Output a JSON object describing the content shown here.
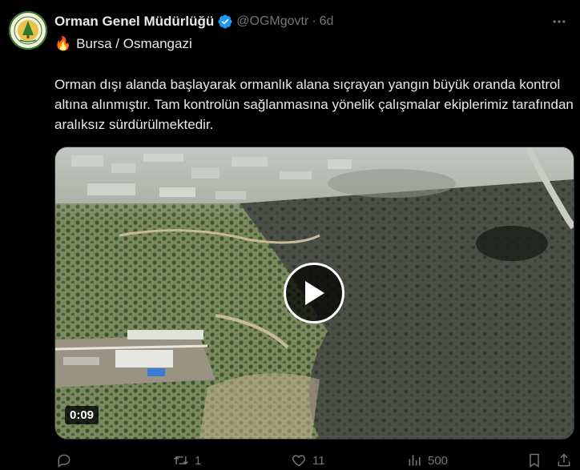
{
  "tweet": {
    "author_name": "Orman Genel Müdürlüğü",
    "handle": "@OGMgovtr",
    "separator": "·",
    "time": "6d",
    "verified_icon": "verified-badge-icon",
    "location_emoji": "🔥",
    "location": "Bursa / Osmangazi",
    "text": "Orman dışı alanda başlayarak ormanlık alana sıçrayan yangın büyük oranda kontrol altına alınmıştır. Tam kontrolün sağlanmasına yönelik çalışmalar ekiplerimiz tarafından aralıksız sürdürülmektedir."
  },
  "media": {
    "type": "video",
    "duration": "0:09",
    "play_icon": "play-icon"
  },
  "actions": {
    "reply_count": "",
    "retweet_count": "1",
    "like_count": "11",
    "views_count": "500"
  },
  "colors": {
    "background": "#000000",
    "text": "#e7e9ea",
    "muted": "#71767b",
    "verified": "#1d9bf0"
  }
}
